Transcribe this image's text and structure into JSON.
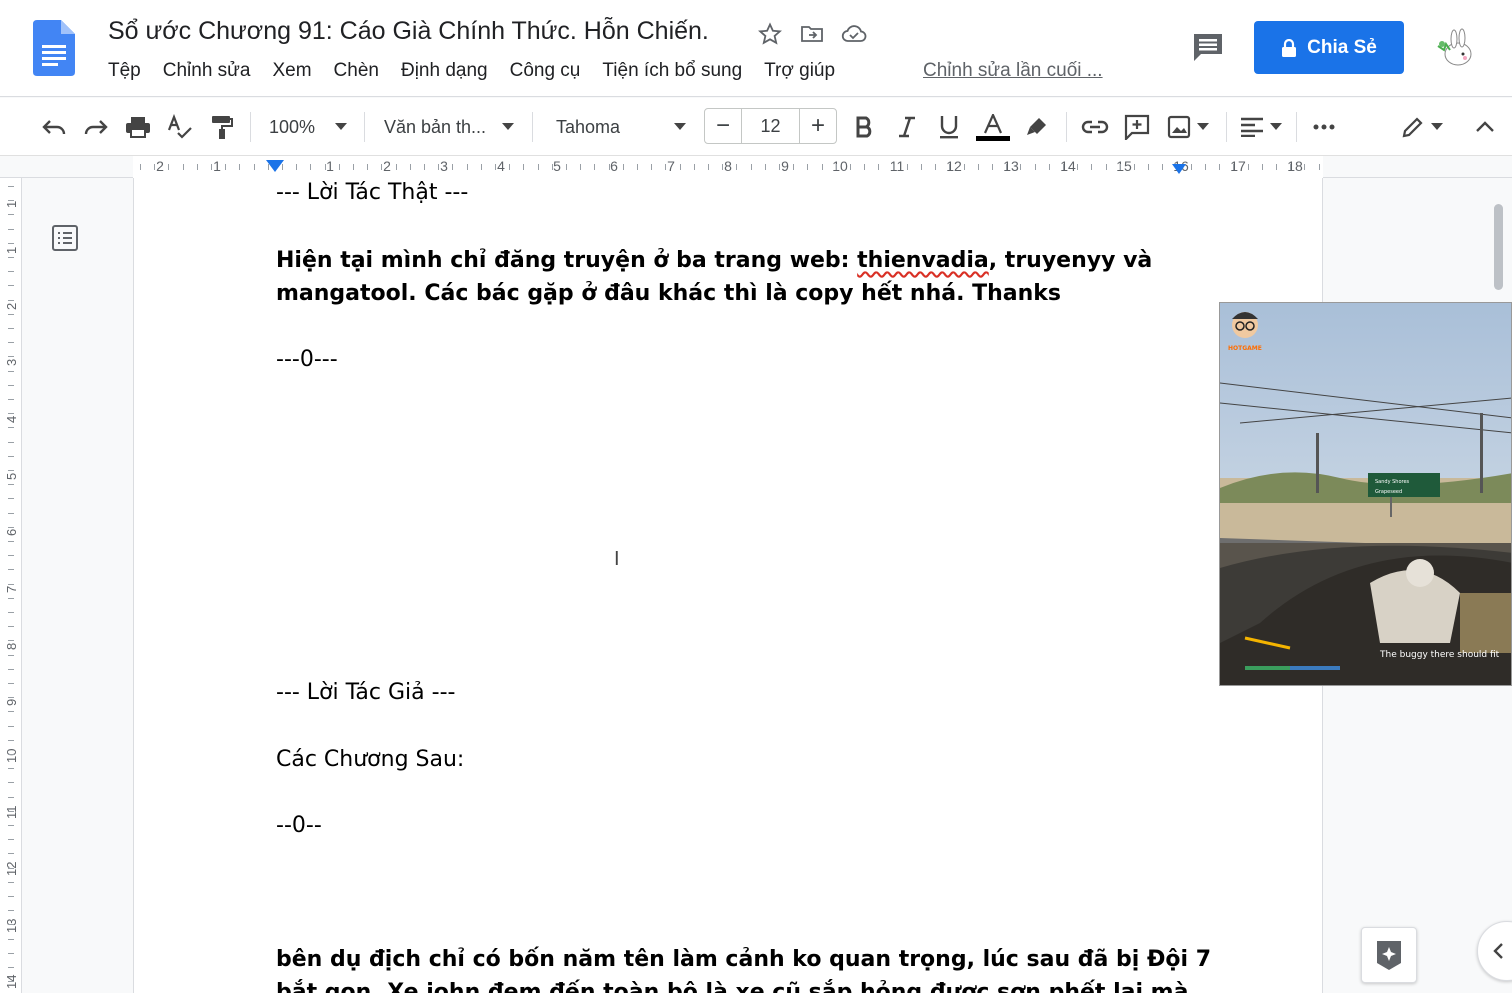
{
  "doc": {
    "title": "Sổ ước Chương 91: Cáo Già Chính Thức. Hỗn Chiến.",
    "last_edit": "Chỉnh sửa lần cuối ..."
  },
  "menu": [
    "Tệp",
    "Chỉnh sửa",
    "Xem",
    "Chèn",
    "Định dạng",
    "Công cụ",
    "Tiện ích bổ sung",
    "Trợ giúp"
  ],
  "share": {
    "label": "Chia Sẻ"
  },
  "toolbar": {
    "zoom": "100%",
    "style": "Văn bản th...",
    "font": "Tahoma",
    "font_size": "12",
    "text_color": "#000000"
  },
  "ruler": {
    "h_numbers": [
      "2",
      "1",
      "1",
      "2",
      "3",
      "4",
      "5",
      "6",
      "7",
      "8",
      "9",
      "10",
      "11",
      "12",
      "13",
      "14",
      "15",
      "16",
      "17",
      "18"
    ],
    "v_numbers": [
      "1",
      "1",
      "2",
      "3",
      "4",
      "5",
      "6",
      "7",
      "8",
      "9",
      "10",
      "11",
      "12",
      "13",
      "14"
    ]
  },
  "content": {
    "line1": "--- Lời Tác Thật ---",
    "line2_a": "Hiện tại mình chỉ đăng truyện ở ba trang web: ",
    "line2_b": "thienvadia",
    "line2_c": ", truyenyy và",
    "line3": "mangatool. Các bác gặp ở đâu khác thì là copy hết nhá. Thanks",
    "line4": "---0---",
    "line5": "--- Lời Tác Giả ---",
    "line6": "Các Chương Sau:",
    "line7": "--0--",
    "line8": "bên dụ địch chỉ có bốn năm tên làm cảnh ko quan trọng, lúc sau đã bị Đội 7",
    "line9": "bắt gọn. Xe john đem đến toàn bộ là xe cũ sắp hỏng được sơn phết lại mà"
  },
  "video": {
    "logo_text": "HOTGAME",
    "subtitle": "The buggy there should fit",
    "sign_line1": "Sandy Shores",
    "sign_line2": "Grapeseed"
  },
  "colors": {
    "accent": "#1a73e8",
    "spell_error": "#d93025"
  }
}
